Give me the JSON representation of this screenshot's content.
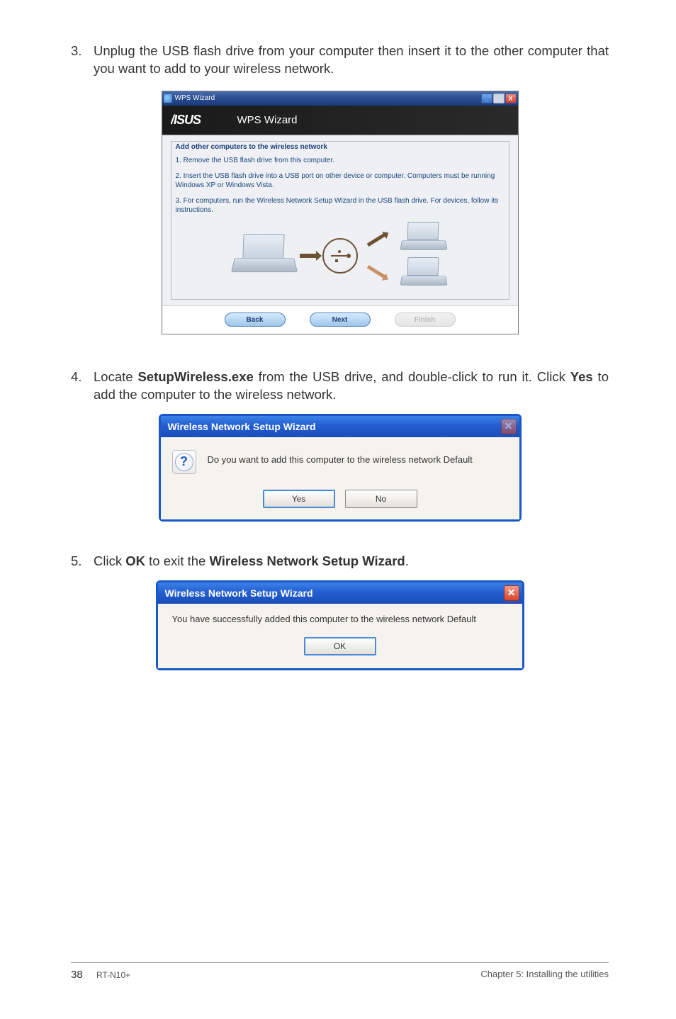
{
  "step3": {
    "num": "3.",
    "text": "Unplug the USB flash drive from your computer then insert it to the other computer that you want to add to your wireless network."
  },
  "wps": {
    "window_title": "WPS Wizard",
    "banner": "WPS Wizard",
    "subtitle": "Add other computers to the wireless network",
    "line1": "1. Remove the USB flash drive from this computer.",
    "line2": "2. Insert the USB flash drive into a USB port on other device or computer. Computers must be running Windows XP or Windows Vista.",
    "line3": "3. For computers, run the Wireless Network Setup Wizard in the USB flash drive. For devices, follow its instructions.",
    "btn_back": "Back",
    "btn_next": "Next",
    "btn_finish": "Finish",
    "min": "_",
    "close": "X"
  },
  "step4": {
    "num": "4.",
    "pre": "Locate ",
    "bold1": "SetupWireless.exe",
    "mid": " from the USB drive, and double-click to run it. Click ",
    "bold2": "Yes",
    "post": " to add the computer to the wireless network."
  },
  "dlg1": {
    "title": "Wireless Network Setup Wizard",
    "msg": "Do you want to add this computer to the wireless network Default",
    "yes": "Yes",
    "no": "No",
    "q": "?"
  },
  "step5": {
    "num": "5.",
    "pre": "Click ",
    "bold1": "OK",
    "mid": " to exit the ",
    "bold2": "Wireless Network Setup Wizard",
    "post": "."
  },
  "dlg2": {
    "title": "Wireless Network Setup Wizard",
    "msg": "You have successfully added this computer to the wireless network Default",
    "ok": "OK"
  },
  "footer": {
    "page": "38",
    "model": "RT-N10+",
    "chapter": "Chapter 5: Installing the utilities"
  }
}
